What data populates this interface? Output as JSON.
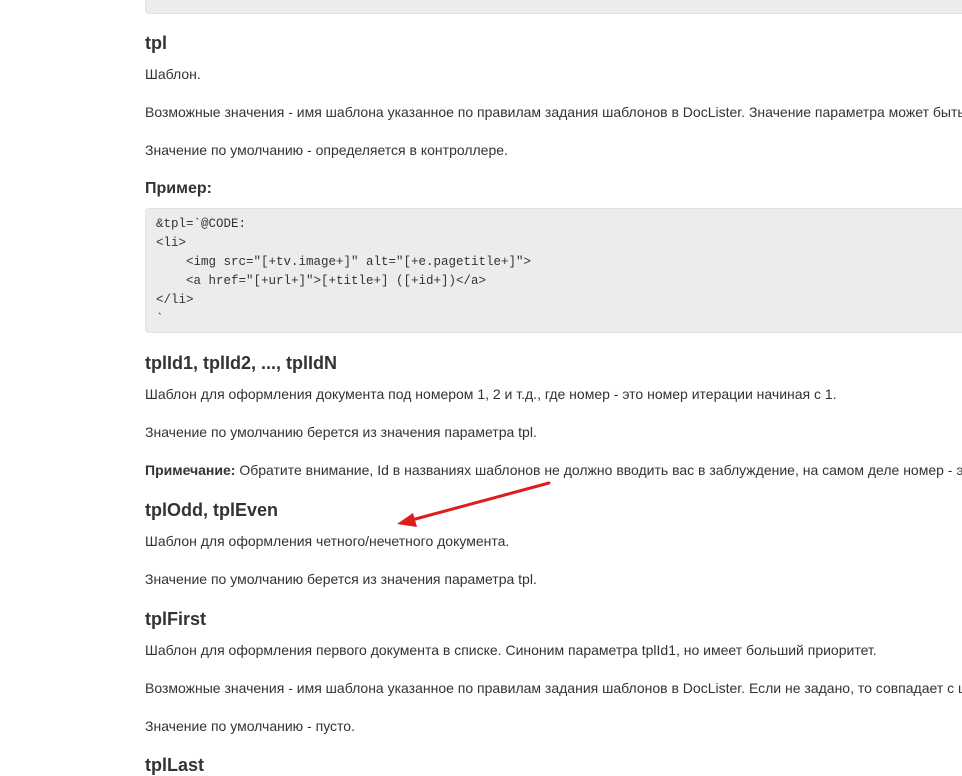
{
  "sections": {
    "tpl": {
      "title": "tpl",
      "desc": "Шаблон.",
      "values": "Возможные значения - имя шаблона указанное по правилам задания шаблонов в DocLister. Значение параметра может быть",
      "default": "Значение по умолчанию - определяется в контроллере.",
      "example_title": "Пример:",
      "code": "&tpl=`@CODE:\n<li>\n    <img src=\"[+tv.image+]\" alt=\"[+e.pagetitle+]\">\n    <a href=\"[+url+]\">[+title+] ([+id+])</a>\n</li>\n`"
    },
    "tplId": {
      "title": "tplId1, tplId2, ..., tplIdN",
      "desc": "Шаблон для оформления документа под номером 1, 2 и т.д., где номер - это номер итерации начиная с 1.",
      "default": "Значение по умолчанию берется из значения параметра tpl.",
      "note_label": "Примечание:",
      "note_text": " Обратите внимание, Id в названиях шаблонов не должно вводить вас в заблуждение, на самом деле номер - э"
    },
    "tplOddEven": {
      "title": "tplOdd, tplEven",
      "desc": "Шаблон для оформления четного/нечетного документа.",
      "default": "Значение по умолчанию берется из значения параметра tpl."
    },
    "tplFirst": {
      "title": "tplFirst",
      "desc": "Шаблон для оформления первого документа в списке. Синоним параметра tplId1, но имеет больший приоритет.",
      "values": "Возможные значения - имя шаблона указанное по правилам задания шаблонов в DocLister. Если не задано, то совпадает с ц",
      "default": "Значение по умолчанию - пусто."
    },
    "tplLast": {
      "title": "tplLast"
    }
  },
  "annotation": {
    "arrow_color": "#e01b1b"
  }
}
